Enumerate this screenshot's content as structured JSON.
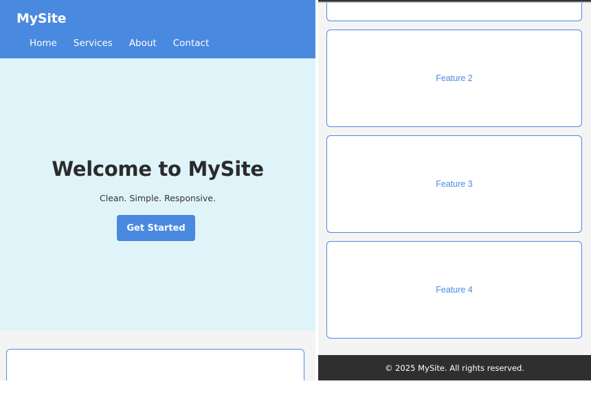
{
  "left_view": {
    "navbar": {
      "brand": "MySite",
      "links": [
        "Home",
        "Services",
        "About",
        "Contact"
      ]
    },
    "hero": {
      "title": "Welcome to MySite",
      "subtitle": "Clean. Simple. Responsive.",
      "cta_label": "Get Started"
    }
  },
  "right_view": {
    "features": [
      "Feature 2",
      "Feature 3",
      "Feature 4"
    ],
    "footer": {
      "text": "© 2025 MySite. All rights reserved."
    }
  },
  "colors": {
    "primary": "#4a89e0",
    "hero_bg": "#dff4f9",
    "page_bg": "#f4f4f4",
    "footer_bg": "#2f2f2f",
    "heading_text": "#2b2b2b"
  }
}
